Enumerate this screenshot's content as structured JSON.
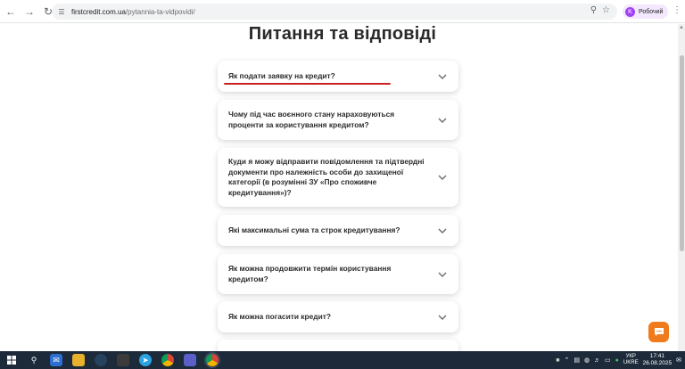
{
  "browser": {
    "url_domain": "firstcredit.com.ua",
    "url_path": "/pytannia-ta-vidpovidi/",
    "profile_initial": "K",
    "profile_name": "Робочий"
  },
  "page": {
    "title": "Питання та відповіді"
  },
  "faq": [
    {
      "question": "Як подати заявку на кредит?"
    },
    {
      "question": "Чому під час воєнного стану нараховуються проценти за користування кредитом?"
    },
    {
      "question": "Куди я можу відправити повідомлення та підтвердні документи про належність особи до захищеної категорії (в розумінні ЗУ «Про споживче кредитування»)?"
    },
    {
      "question": "Які максимальні сума та строк кредитування?"
    },
    {
      "question": "Як можна продовжити термін користування кредитом?"
    },
    {
      "question": "Як можна погасити кредит?"
    }
  ],
  "colors": {
    "accent_underline": "#c8201e",
    "chat_button": "#f07b1c",
    "taskbar": "#1c2a3a"
  },
  "taskbar": {
    "lang_top": "УКР",
    "lang_bottom": "UKRE",
    "time": "17:41",
    "date": "26.08.2025"
  }
}
